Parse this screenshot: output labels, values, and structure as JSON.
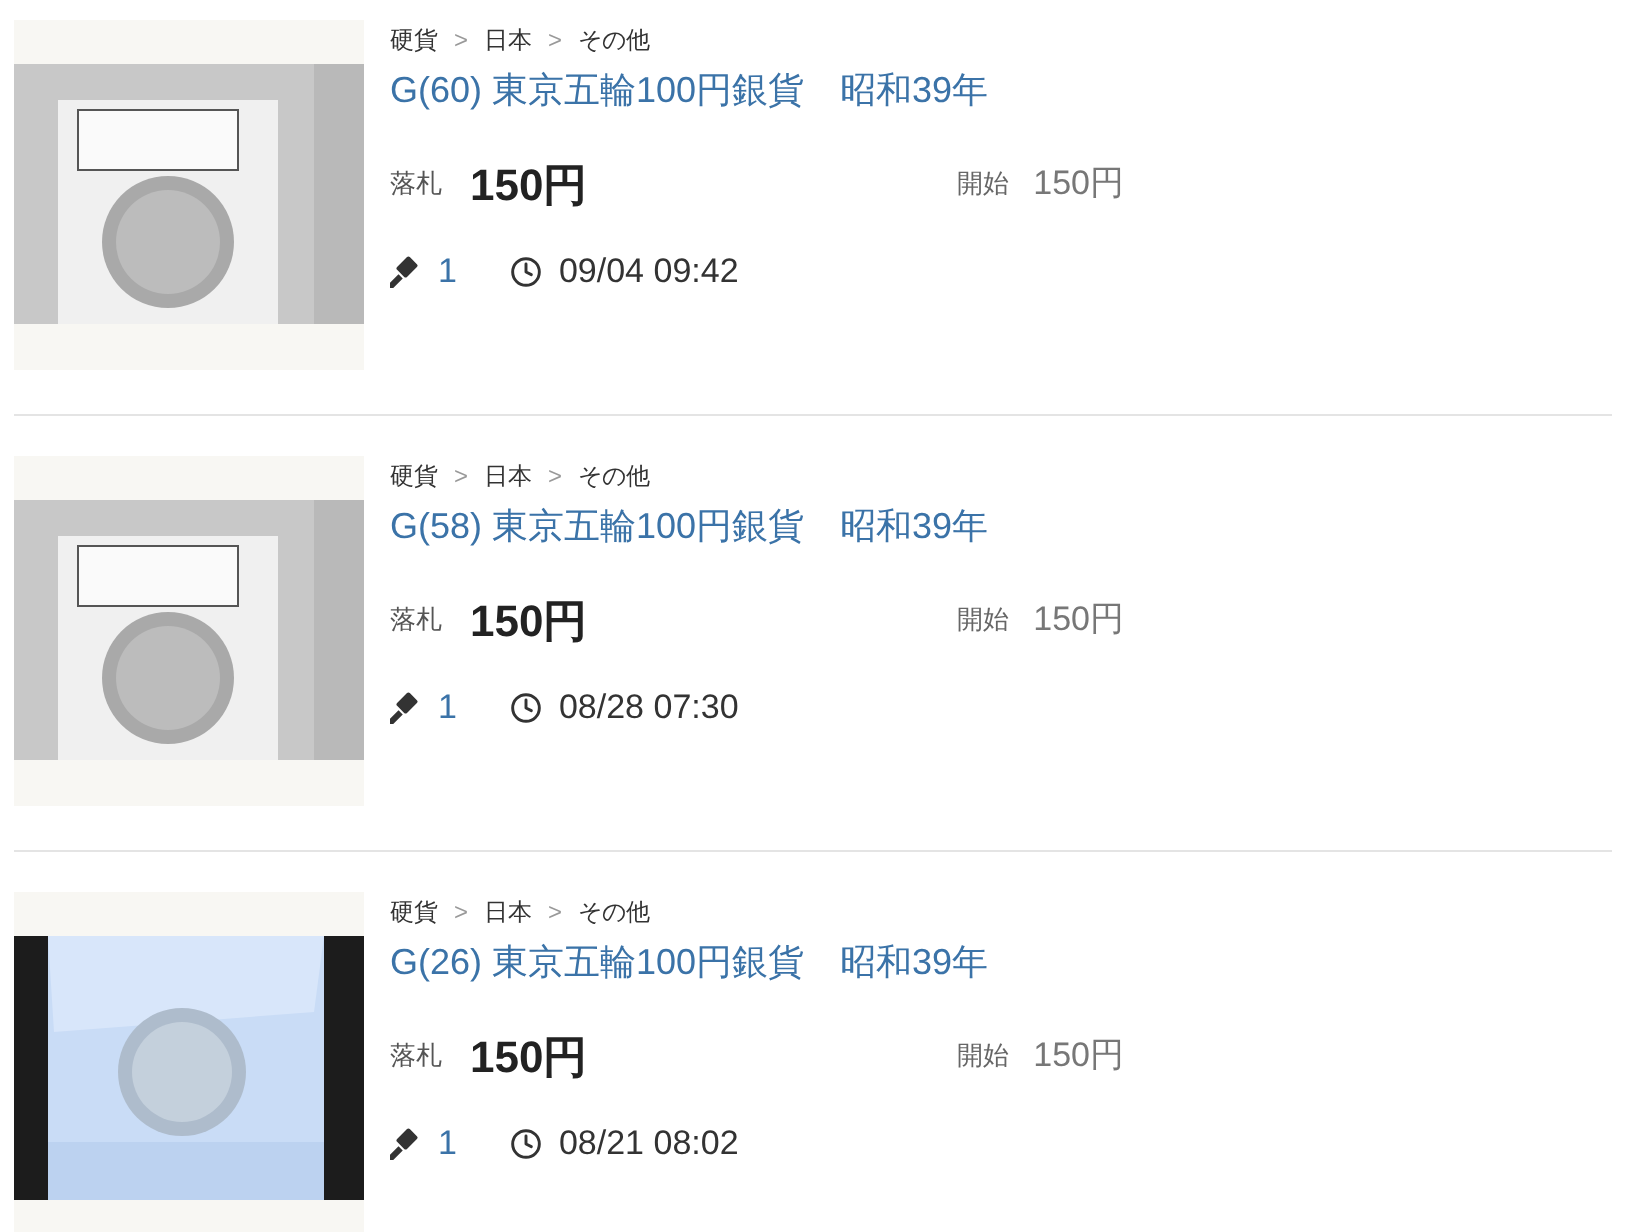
{
  "items": [
    {
      "breadcrumb": [
        "硬貨",
        "日本",
        "その他"
      ],
      "separator": ">",
      "title": "G(60) 東京五輪100円銀貨　昭和39年",
      "price_label": "落札",
      "price": "150円",
      "start_label": "開始",
      "start_price": "150円",
      "bids": "1",
      "end_time": "09/04 09:42"
    },
    {
      "breadcrumb": [
        "硬貨",
        "日本",
        "その他"
      ],
      "separator": ">",
      "title": "G(58) 東京五輪100円銀貨　昭和39年",
      "price_label": "落札",
      "price": "150円",
      "start_label": "開始",
      "start_price": "150円",
      "bids": "1",
      "end_time": "08/28 07:30"
    },
    {
      "breadcrumb": [
        "硬貨",
        "日本",
        "その他"
      ],
      "separator": ">",
      "title": "G(26) 東京五輪100円銀貨　昭和39年",
      "price_label": "落札",
      "price": "150円",
      "start_label": "開始",
      "start_price": "150円",
      "bids": "1",
      "end_time": "08/21 08:02"
    }
  ]
}
